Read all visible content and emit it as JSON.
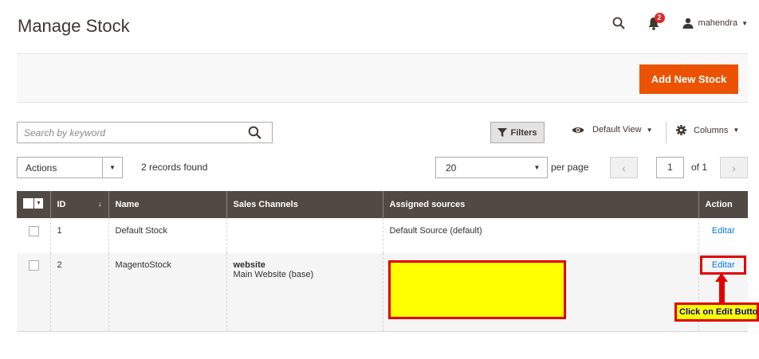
{
  "header": {
    "title": "Manage Stock",
    "notifications_count": "2",
    "username": "mahendra"
  },
  "page_actions": {
    "add_button": "Add New Stock"
  },
  "toolbar": {
    "search_placeholder": "Search by keyword",
    "filters_label": "Filters",
    "view_label": "Default View",
    "columns_label": "Columns",
    "actions_label": "Actions",
    "records_found": "2 records found",
    "per_page_value": "20",
    "per_page_label": "per page",
    "current_page": "1",
    "page_of": "of 1"
  },
  "table": {
    "columns": [
      "ID",
      "Name",
      "Sales Channels",
      "Assigned sources",
      "Action"
    ],
    "rows": [
      {
        "id": "1",
        "name": "Default Stock",
        "channel_type": "",
        "channel_name": "",
        "sources": "Default Source (default)",
        "action": "Editar"
      },
      {
        "id": "2",
        "name": "MagentoStock",
        "channel_type": "website",
        "channel_name": "Main Website (base)",
        "sources": "",
        "action": "Editar"
      }
    ]
  },
  "annotation": {
    "callout_text": "Click on Edit Button"
  },
  "colors": {
    "accent": "#eb5202",
    "grid_header": "#514943",
    "link": "#007bdb",
    "annotation_red": "#e00000",
    "highlight_yellow": "#ffff00"
  }
}
